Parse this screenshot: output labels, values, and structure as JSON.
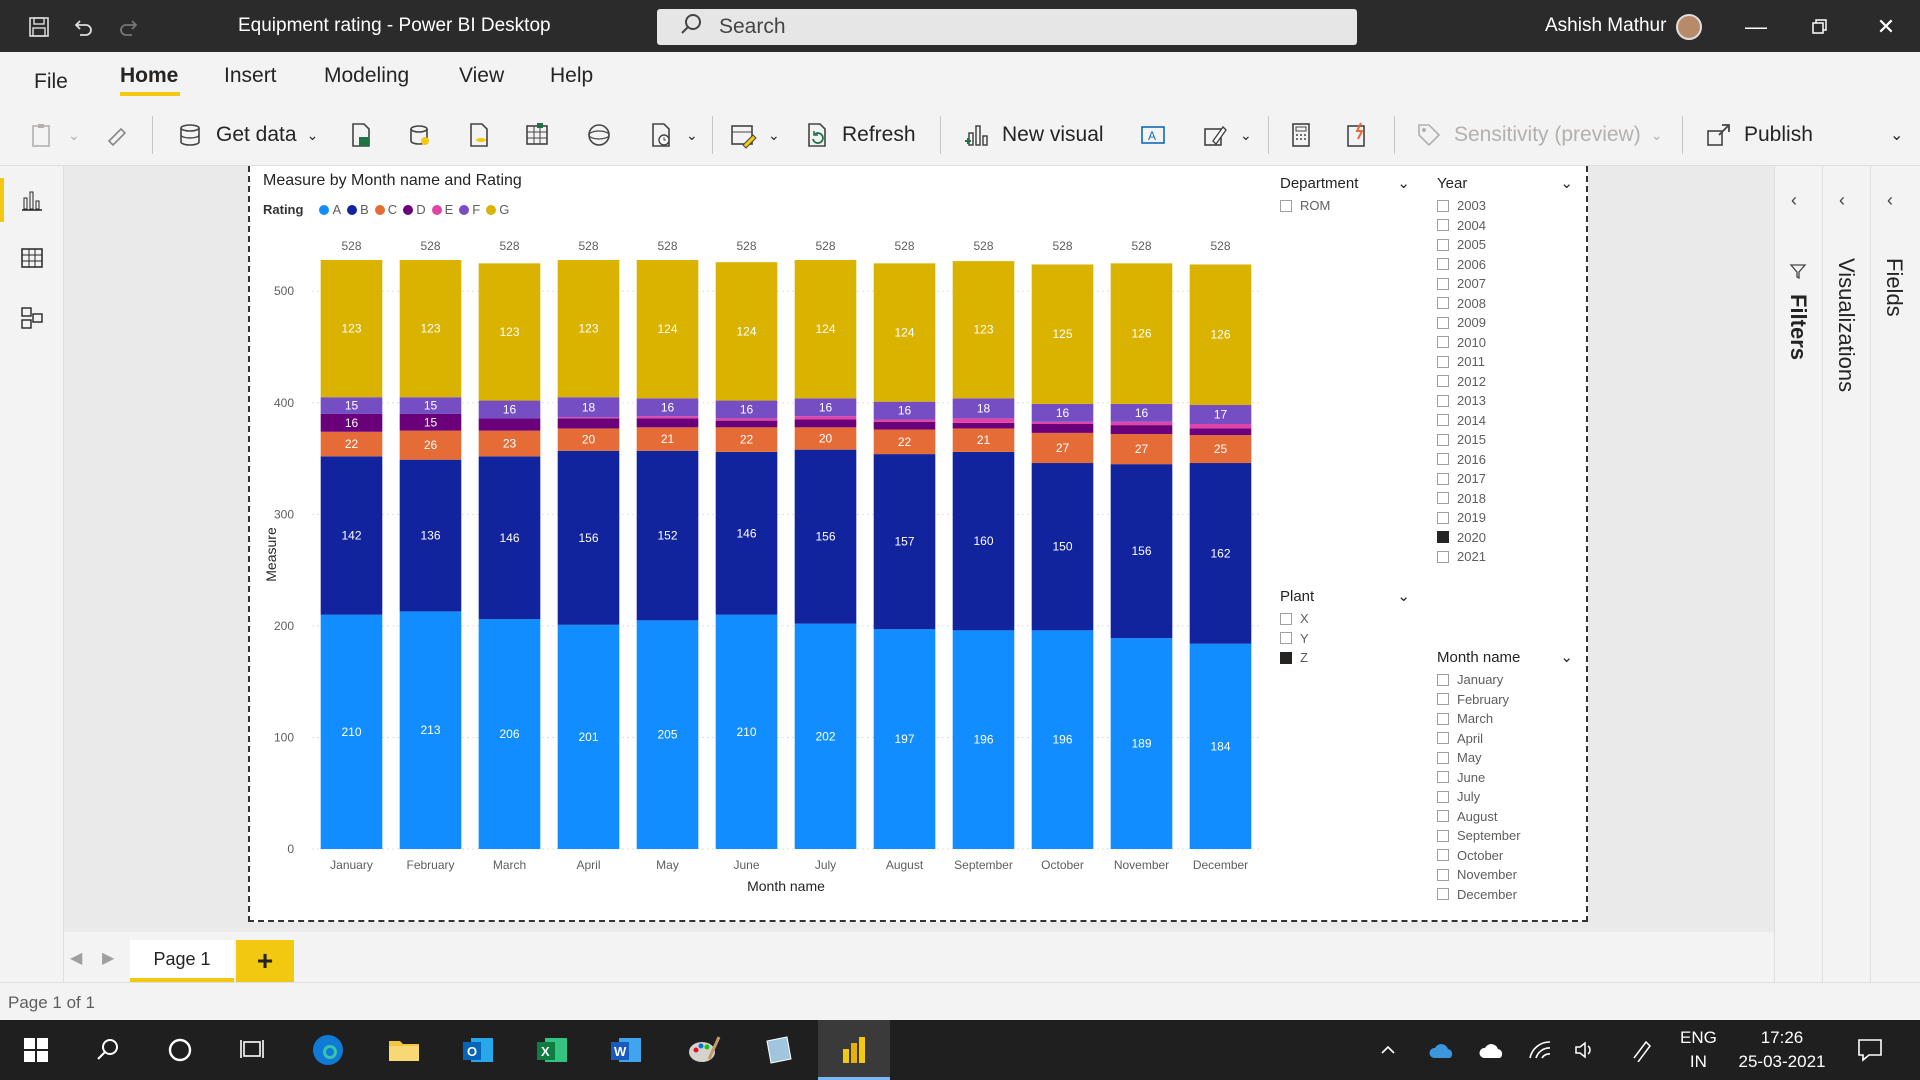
{
  "window": {
    "title": "Equipment rating - Power BI Desktop",
    "search_placeholder": "Search",
    "user_name": "Ashish Mathur"
  },
  "menu": {
    "items": [
      "File",
      "Home",
      "Insert",
      "Modeling",
      "View",
      "Help"
    ],
    "active": "Home"
  },
  "ribbon": {
    "get_data": "Get data",
    "refresh": "Refresh",
    "new_visual": "New visual",
    "sensitivity": "Sensitivity (preview)",
    "publish": "Publish"
  },
  "chart_data": {
    "type": "bar",
    "stacked": true,
    "title": "Measure by Month name and Rating",
    "legend_title": "Rating",
    "legend_position": "top-left",
    "xlabel": "Month name",
    "ylabel": "Measure",
    "ylim": [
      0,
      528
    ],
    "yticks": [
      0,
      100,
      200,
      300,
      400,
      500
    ],
    "grid": true,
    "categories": [
      "January",
      "February",
      "March",
      "April",
      "May",
      "June",
      "July",
      "August",
      "September",
      "October",
      "November",
      "December"
    ],
    "totals": [
      528,
      528,
      528,
      528,
      528,
      528,
      528,
      528,
      528,
      528,
      528,
      528
    ],
    "series": [
      {
        "name": "A",
        "color": "#118dff",
        "values": [
          210,
          213,
          206,
          201,
          205,
          210,
          202,
          197,
          196,
          196,
          189,
          184
        ]
      },
      {
        "name": "B",
        "color": "#12239e",
        "values": [
          142,
          136,
          146,
          156,
          152,
          146,
          156,
          157,
          160,
          150,
          156,
          162
        ]
      },
      {
        "name": "C",
        "color": "#e66c37",
        "values": [
          22,
          26,
          23,
          20,
          21,
          22,
          20,
          22,
          21,
          27,
          27,
          25
        ]
      },
      {
        "name": "D",
        "color": "#6b007b",
        "values": [
          16,
          15,
          11,
          9,
          8,
          6,
          7,
          7,
          5,
          8,
          8,
          6
        ]
      },
      {
        "name": "E",
        "color": "#e044a7",
        "values": [
          0,
          0,
          0,
          1,
          2,
          2,
          3,
          2,
          4,
          2,
          3,
          4
        ]
      },
      {
        "name": "F",
        "color": "#744ec2",
        "values": [
          15,
          15,
          16,
          18,
          16,
          16,
          16,
          16,
          18,
          16,
          16,
          17
        ]
      },
      {
        "name": "G",
        "color": "#d9b300",
        "values": [
          123,
          123,
          123,
          123,
          124,
          124,
          124,
          124,
          123,
          125,
          126,
          126
        ]
      }
    ],
    "data_labels": {
      "A": [
        210,
        213,
        206,
        201,
        205,
        210,
        202,
        197,
        196,
        196,
        189,
        184
      ],
      "B": [
        142,
        136,
        146,
        156,
        152,
        146,
        156,
        157,
        160,
        150,
        156,
        162
      ],
      "C": [
        22,
        26,
        23,
        20,
        21,
        22,
        20,
        22,
        21,
        27,
        27,
        25
      ],
      "D": [
        16,
        15,
        null,
        null,
        null,
        null,
        null,
        null,
        null,
        null,
        null,
        null
      ],
      "F": [
        15,
        15,
        16,
        18,
        16,
        16,
        16,
        16,
        18,
        16,
        16,
        17
      ],
      "G": [
        123,
        123,
        123,
        123,
        124,
        124,
        124,
        124,
        123,
        125,
        126,
        126
      ]
    }
  },
  "slicers": {
    "department": {
      "title": "Department",
      "items": [
        {
          "label": "ROM",
          "checked": false
        }
      ]
    },
    "plant": {
      "title": "Plant",
      "items": [
        {
          "label": "X",
          "checked": false
        },
        {
          "label": "Y",
          "checked": false
        },
        {
          "label": "Z",
          "checked": true
        }
      ]
    },
    "year": {
      "title": "Year",
      "items": [
        {
          "label": "2003",
          "checked": false
        },
        {
          "label": "2004",
          "checked": false
        },
        {
          "label": "2005",
          "checked": false
        },
        {
          "label": "2006",
          "checked": false
        },
        {
          "label": "2007",
          "checked": false
        },
        {
          "label": "2008",
          "checked": false
        },
        {
          "label": "2009",
          "checked": false
        },
        {
          "label": "2010",
          "checked": false
        },
        {
          "label": "2011",
          "checked": false
        },
        {
          "label": "2012",
          "checked": false
        },
        {
          "label": "2013",
          "checked": false
        },
        {
          "label": "2014",
          "checked": false
        },
        {
          "label": "2015",
          "checked": false
        },
        {
          "label": "2016",
          "checked": false
        },
        {
          "label": "2017",
          "checked": false
        },
        {
          "label": "2018",
          "checked": false
        },
        {
          "label": "2019",
          "checked": false
        },
        {
          "label": "2020",
          "checked": true
        },
        {
          "label": "2021",
          "checked": false
        }
      ]
    },
    "month": {
      "title": "Month name",
      "items": [
        {
          "label": "January",
          "checked": false
        },
        {
          "label": "February",
          "checked": false
        },
        {
          "label": "March",
          "checked": false
        },
        {
          "label": "April",
          "checked": false
        },
        {
          "label": "May",
          "checked": false
        },
        {
          "label": "June",
          "checked": false
        },
        {
          "label": "July",
          "checked": false
        },
        {
          "label": "August",
          "checked": false
        },
        {
          "label": "September",
          "checked": false
        },
        {
          "label": "October",
          "checked": false
        },
        {
          "label": "November",
          "checked": false
        },
        {
          "label": "December",
          "checked": false
        }
      ]
    }
  },
  "panes": {
    "filters": "Filters",
    "visualizations": "Visualizations",
    "fields": "Fields"
  },
  "pages": {
    "tab": "Page 1",
    "add": "+",
    "status": "Page 1 of 1"
  },
  "taskbar": {
    "lang_top": "ENG",
    "lang_bottom": "IN",
    "time": "17:26",
    "date": "25-03-2021"
  }
}
